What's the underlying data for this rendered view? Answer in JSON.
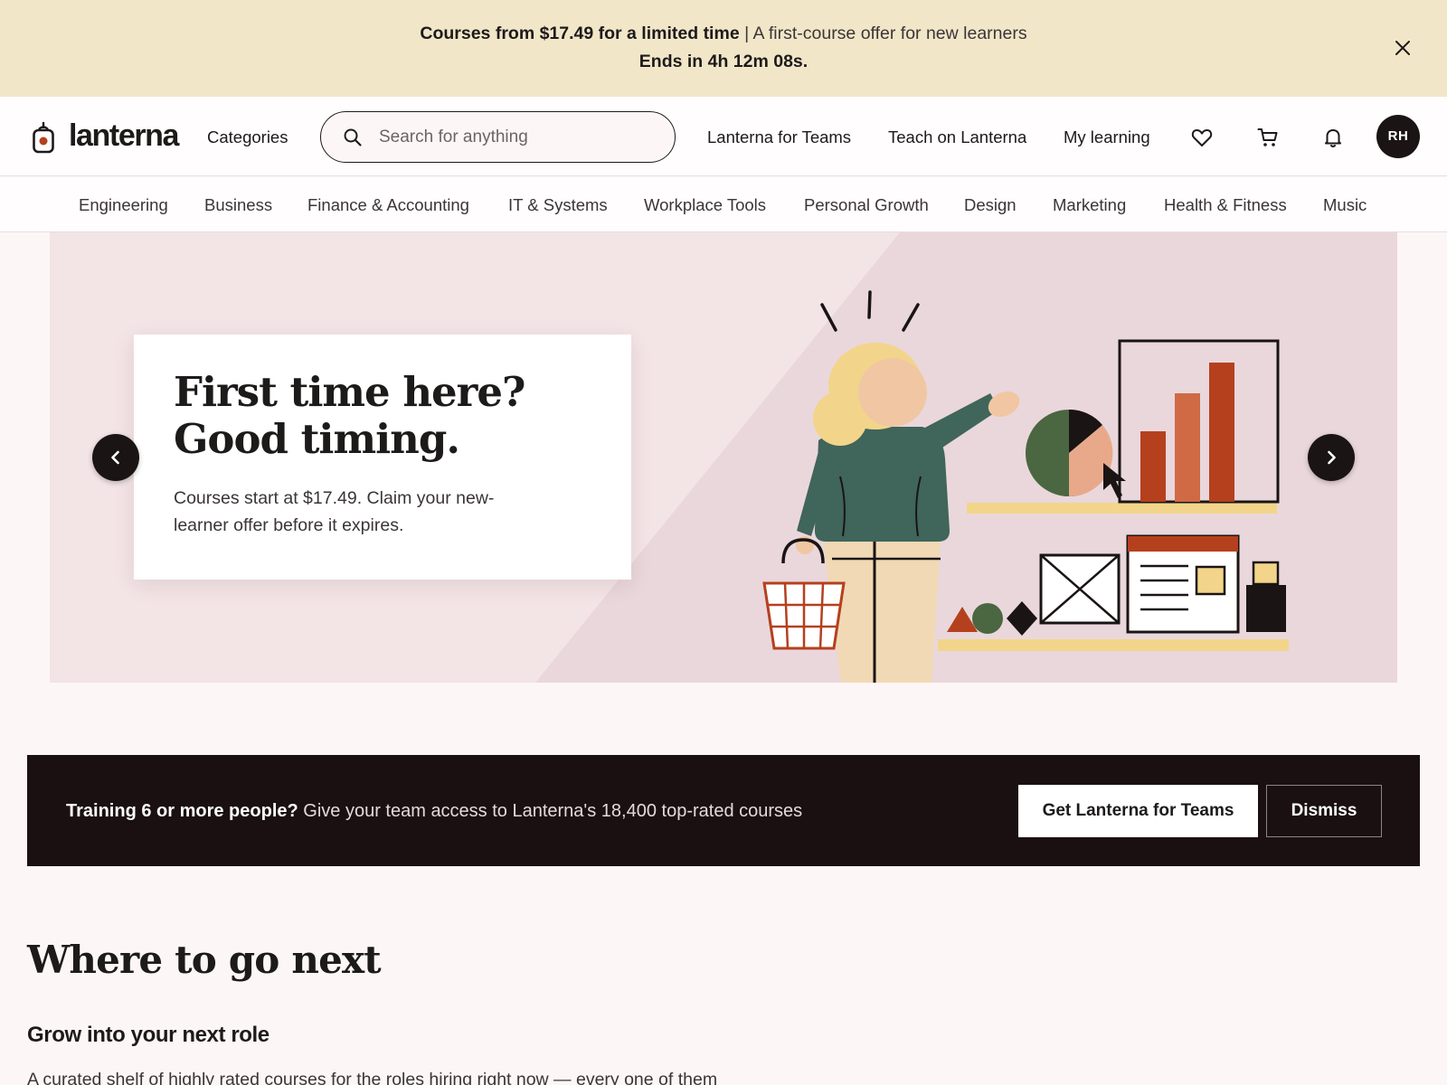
{
  "promo": {
    "headline": "Courses from $17.49 for a limited time",
    "separator": " | ",
    "detail": "A first-course offer for new learners",
    "countdown": "Ends in 4h 12m 08s.",
    "close_icon": "close-icon"
  },
  "header": {
    "brand": "lanterna",
    "logo_icon": "lantern-icon",
    "categories_label": "Categories",
    "search": {
      "placeholder": "Search for anything",
      "value": ""
    },
    "links": {
      "teams": "Lanterna for Teams",
      "teach": "Teach on Lanterna",
      "learning": "My learning"
    },
    "icons": [
      "heart-icon",
      "cart-icon",
      "bell-icon"
    ],
    "avatar_initials": "RH"
  },
  "categories": [
    "Engineering",
    "Business",
    "Finance & Accounting",
    "IT & Systems",
    "Workplace Tools",
    "Personal Growth",
    "Design",
    "Marketing",
    "Health & Fitness",
    "Music"
  ],
  "hero": {
    "title": "First time here? Good timing.",
    "text": "Courses start at $17.49. Claim your new-learner offer before it expires.",
    "prev_icon": "chevron-left-icon",
    "next_icon": "chevron-right-icon"
  },
  "teams_bar": {
    "lead": "Training 6 or more people?",
    "text": " Give your team access to Lanterna's 18,400 top-rated courses",
    "cta": "Get Lanterna for Teams",
    "dismiss": "Dismiss"
  },
  "section": {
    "title": "Where to go next",
    "subtitle": "Grow into your next role",
    "description": "A curated shelf of highly rated courses for the roles hiring right now — every one of them"
  },
  "colors": {
    "promo_bg": "#f2e6c9",
    "page_bg": "#fcf7f6",
    "hero_bg": "#f3e4e6",
    "dark": "#1a1012",
    "accent_rust": "#b5401e",
    "accent_green": "#4a6741"
  }
}
